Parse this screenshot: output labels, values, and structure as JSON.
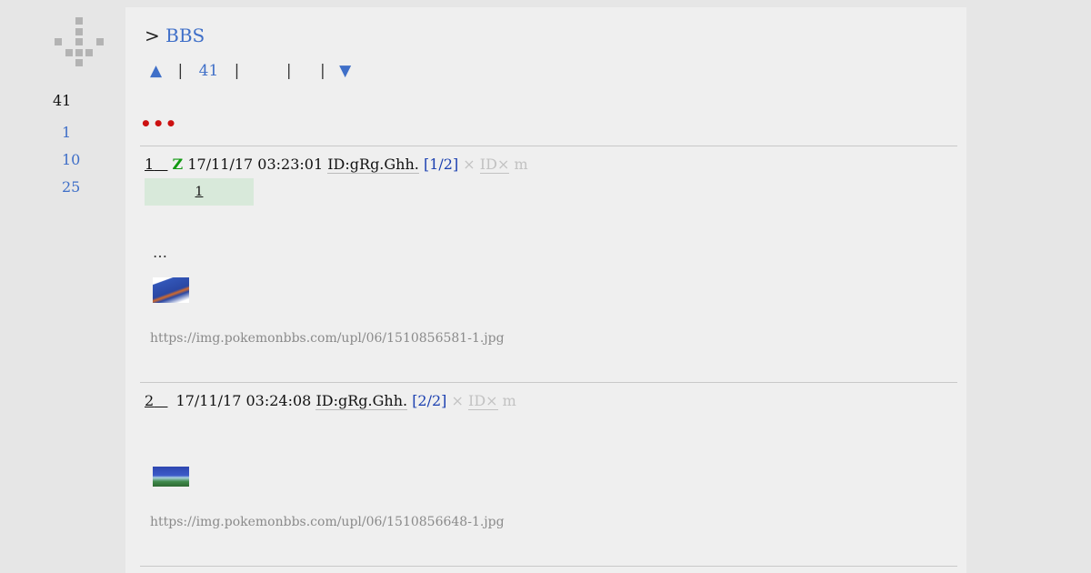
{
  "sidebar": {
    "count": "41",
    "links": [
      "1",
      "10",
      "25"
    ]
  },
  "header": {
    "prefix": ">",
    "board_link": "BBS"
  },
  "nav": {
    "up": "▲",
    "sep": "|",
    "page": "41",
    "down": "▼"
  },
  "notice_dots": "•••",
  "posts": [
    {
      "number": "1",
      "name": "Z",
      "datetime": "17/11/17 03:23:01",
      "id": "ID:gRg.Ghh.",
      "ref": "[1/2]",
      "x1": "×",
      "idx": "ID×",
      "m": "m",
      "reply_count": "1",
      "text": "…",
      "image_url": "https://img.pokemonbbs.com/upl/06/1510856581-1.jpg"
    },
    {
      "number": "2",
      "datetime": "17/11/17 03:24:08",
      "id": "ID:gRg.Ghh.",
      "ref": "[2/2]",
      "x1": "×",
      "idx": "ID×",
      "m": "m",
      "image_url": "https://img.pokemonbbs.com/upl/06/1510856648-1.jpg"
    }
  ],
  "colors": {
    "link": "#3f6fc8",
    "accent_red": "#cc1111",
    "name_green": "#119911",
    "ref_blue": "#1a3fb0"
  }
}
